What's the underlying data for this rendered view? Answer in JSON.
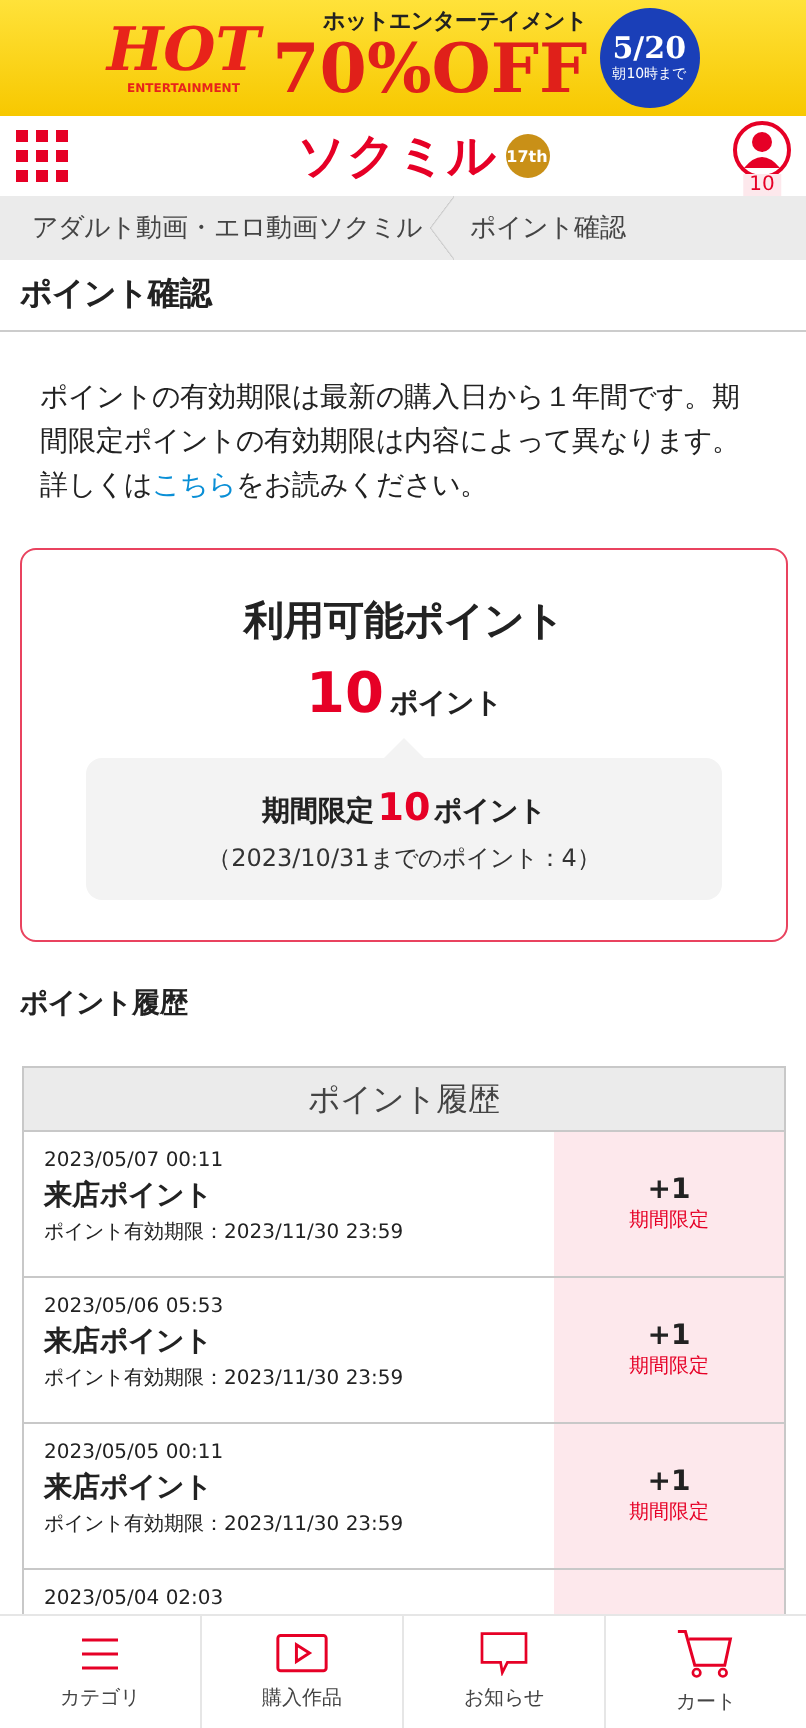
{
  "banner": {
    "brand": "HOT",
    "brand_sub": "ENTERTAINMENT",
    "headline": "70%OFF",
    "kicker": "ホットエンターテイメント",
    "date": "5/20",
    "until": "朝10時まで"
  },
  "header": {
    "logo": "ソクミル",
    "anniversary": "17th",
    "user_badge": "10"
  },
  "breadcrumb": [
    "アダルト動画・エロ動画ソクミル",
    "ポイント確認"
  ],
  "page_title": "ポイント確認",
  "notice": {
    "text": "ポイントの有効期限は最新の購入日から１年間です。期間限定ポイントの有効期限は内容によって異なります。詳しくは",
    "link": "こちら",
    "after": "をお読みください。"
  },
  "summary": {
    "title": "利用可能ポイント",
    "points": "10",
    "unit": "ポイント",
    "limited": {
      "label": "期間限定",
      "points": "10",
      "unit": "ポイント",
      "note": "（2023/10/31までのポイント：4）"
    }
  },
  "history_title": "ポイント履歴",
  "table": {
    "header": "ポイント履歴",
    "rows": [
      {
        "date": "2023/05/07 00:11",
        "name": "来店ポイント",
        "expiry": "ポイント有効期限：2023/11/30 23:59",
        "points": "+1",
        "tag": "期間限定"
      },
      {
        "date": "2023/05/06 05:53",
        "name": "来店ポイント",
        "expiry": "ポイント有効期限：2023/11/30 23:59",
        "points": "+1",
        "tag": "期間限定"
      },
      {
        "date": "2023/05/05 00:11",
        "name": "来店ポイント",
        "expiry": "ポイント有効期限：2023/11/30 23:59",
        "points": "+1",
        "tag": "期間限定"
      },
      {
        "date": "2023/05/04 02:03"
      }
    ]
  },
  "nav": [
    {
      "kind": "menu",
      "label": "カテゴリ"
    },
    {
      "kind": "play",
      "label": "購入作品"
    },
    {
      "kind": "chat",
      "label": "お知らせ"
    },
    {
      "kind": "cart",
      "label": "カート"
    }
  ]
}
